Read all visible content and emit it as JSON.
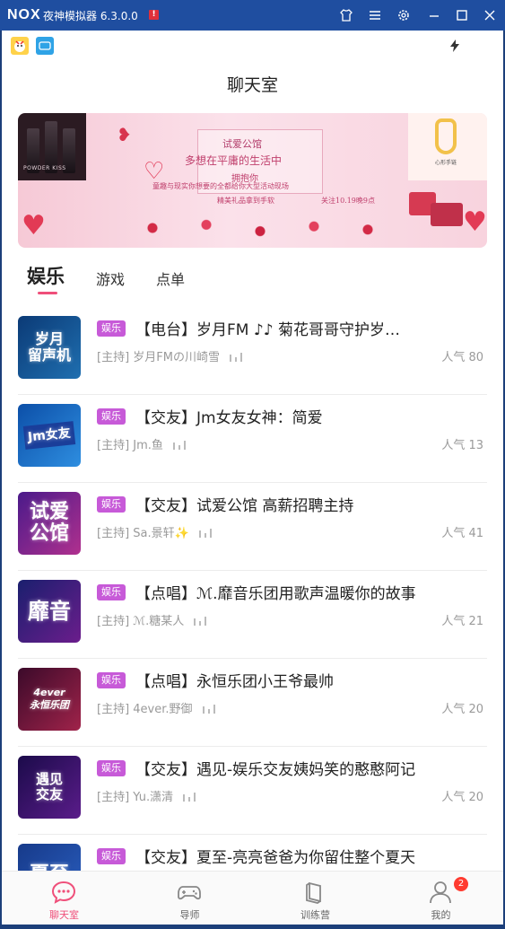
{
  "emulator": {
    "logo": "NOX",
    "title": "夜神模拟器 6.3.0.0",
    "alert_icon_label": "!",
    "buttons": [
      "theme-icon",
      "menu-icon",
      "settings-icon",
      "minimize-icon",
      "maximize-icon",
      "close-icon"
    ]
  },
  "page": {
    "title": "聊天室"
  },
  "banner": {
    "title": "试爱公馆",
    "lines": [
      "多想在平庸的生活中",
      "拥抱你",
      "童趣与现实你想要的全都给你大型活动现场",
      "精美礼品拿到手软",
      "关注10.19晚9点"
    ],
    "perfume_text": "POWDER KISS",
    "card_text": "心形手链"
  },
  "tabs": [
    {
      "label": "娱乐",
      "active": true
    },
    {
      "label": "游戏",
      "active": false
    },
    {
      "label": "点单",
      "active": false
    }
  ],
  "rooms": [
    {
      "cover": "岁月\n留声机",
      "tag": "娱乐",
      "title": "【电台】岁月FM ♪♪ 菊花哥哥守护岁…",
      "host": "[主持] 岁月FMの川崎雪",
      "popularity": "人气 80",
      "colors": [
        "#0b3a76",
        "#1f6fb0"
      ]
    },
    {
      "cover": "Jm女友",
      "tag": "娱乐",
      "title": "【交友】Jm女友女神：简爱",
      "host": "[主持] Jm.鱼",
      "popularity": "人气 13",
      "colors": [
        "#0c4fa8",
        "#2e8ee0"
      ]
    },
    {
      "cover": "试爱\n公馆",
      "tag": "娱乐",
      "title": "【交友】试爱公馆 高薪招聘主持",
      "host": "[主持] Sa.景轩✨",
      "popularity": "人气 41",
      "colors": [
        "#4a1a8a",
        "#b0308e"
      ]
    },
    {
      "cover": "靡音",
      "tag": "娱乐",
      "title": "【点唱】ℳ.靡音乐团用歌声温暖你的故事",
      "host": "[主持] ℳ.糖某人",
      "popularity": "人气 21",
      "colors": [
        "#1a1f6e",
        "#6b1d8c"
      ]
    },
    {
      "cover": "4ever\n永恒乐团",
      "tag": "娱乐",
      "title": "【点唱】永恒乐团小王爷最帅",
      "host": "[主持] 4ever.野御",
      "popularity": "人气 20",
      "colors": [
        "#3b0a2a",
        "#a0234a"
      ]
    },
    {
      "cover": "遇见\n交友",
      "tag": "娱乐",
      "title": "【交友】遇见-娱乐交友姨妈笑的憨憨阿记",
      "host": "[主持] Yu.潇清",
      "popularity": "人气 20",
      "colors": [
        "#1b0b4a",
        "#5a1c8a"
      ]
    },
    {
      "cover": "夏至",
      "tag": "娱乐",
      "title": "【交友】夏至-亮亮爸爸为你留住整个夏天",
      "host": "",
      "popularity": "",
      "colors": [
        "#173a8a",
        "#2a5fc0"
      ]
    }
  ],
  "bottom_nav": [
    {
      "label": "聊天室",
      "icon": "chat-icon",
      "active": true
    },
    {
      "label": "导师",
      "icon": "gamepad-icon",
      "active": false
    },
    {
      "label": "训练营",
      "icon": "book-icon",
      "active": false
    },
    {
      "label": "我的",
      "icon": "profile-icon",
      "active": false,
      "badge": "2"
    }
  ],
  "colors": {
    "accent": "#ef4f7a",
    "tag": "#c75ad8",
    "titlebar": "#1f4ea0"
  }
}
